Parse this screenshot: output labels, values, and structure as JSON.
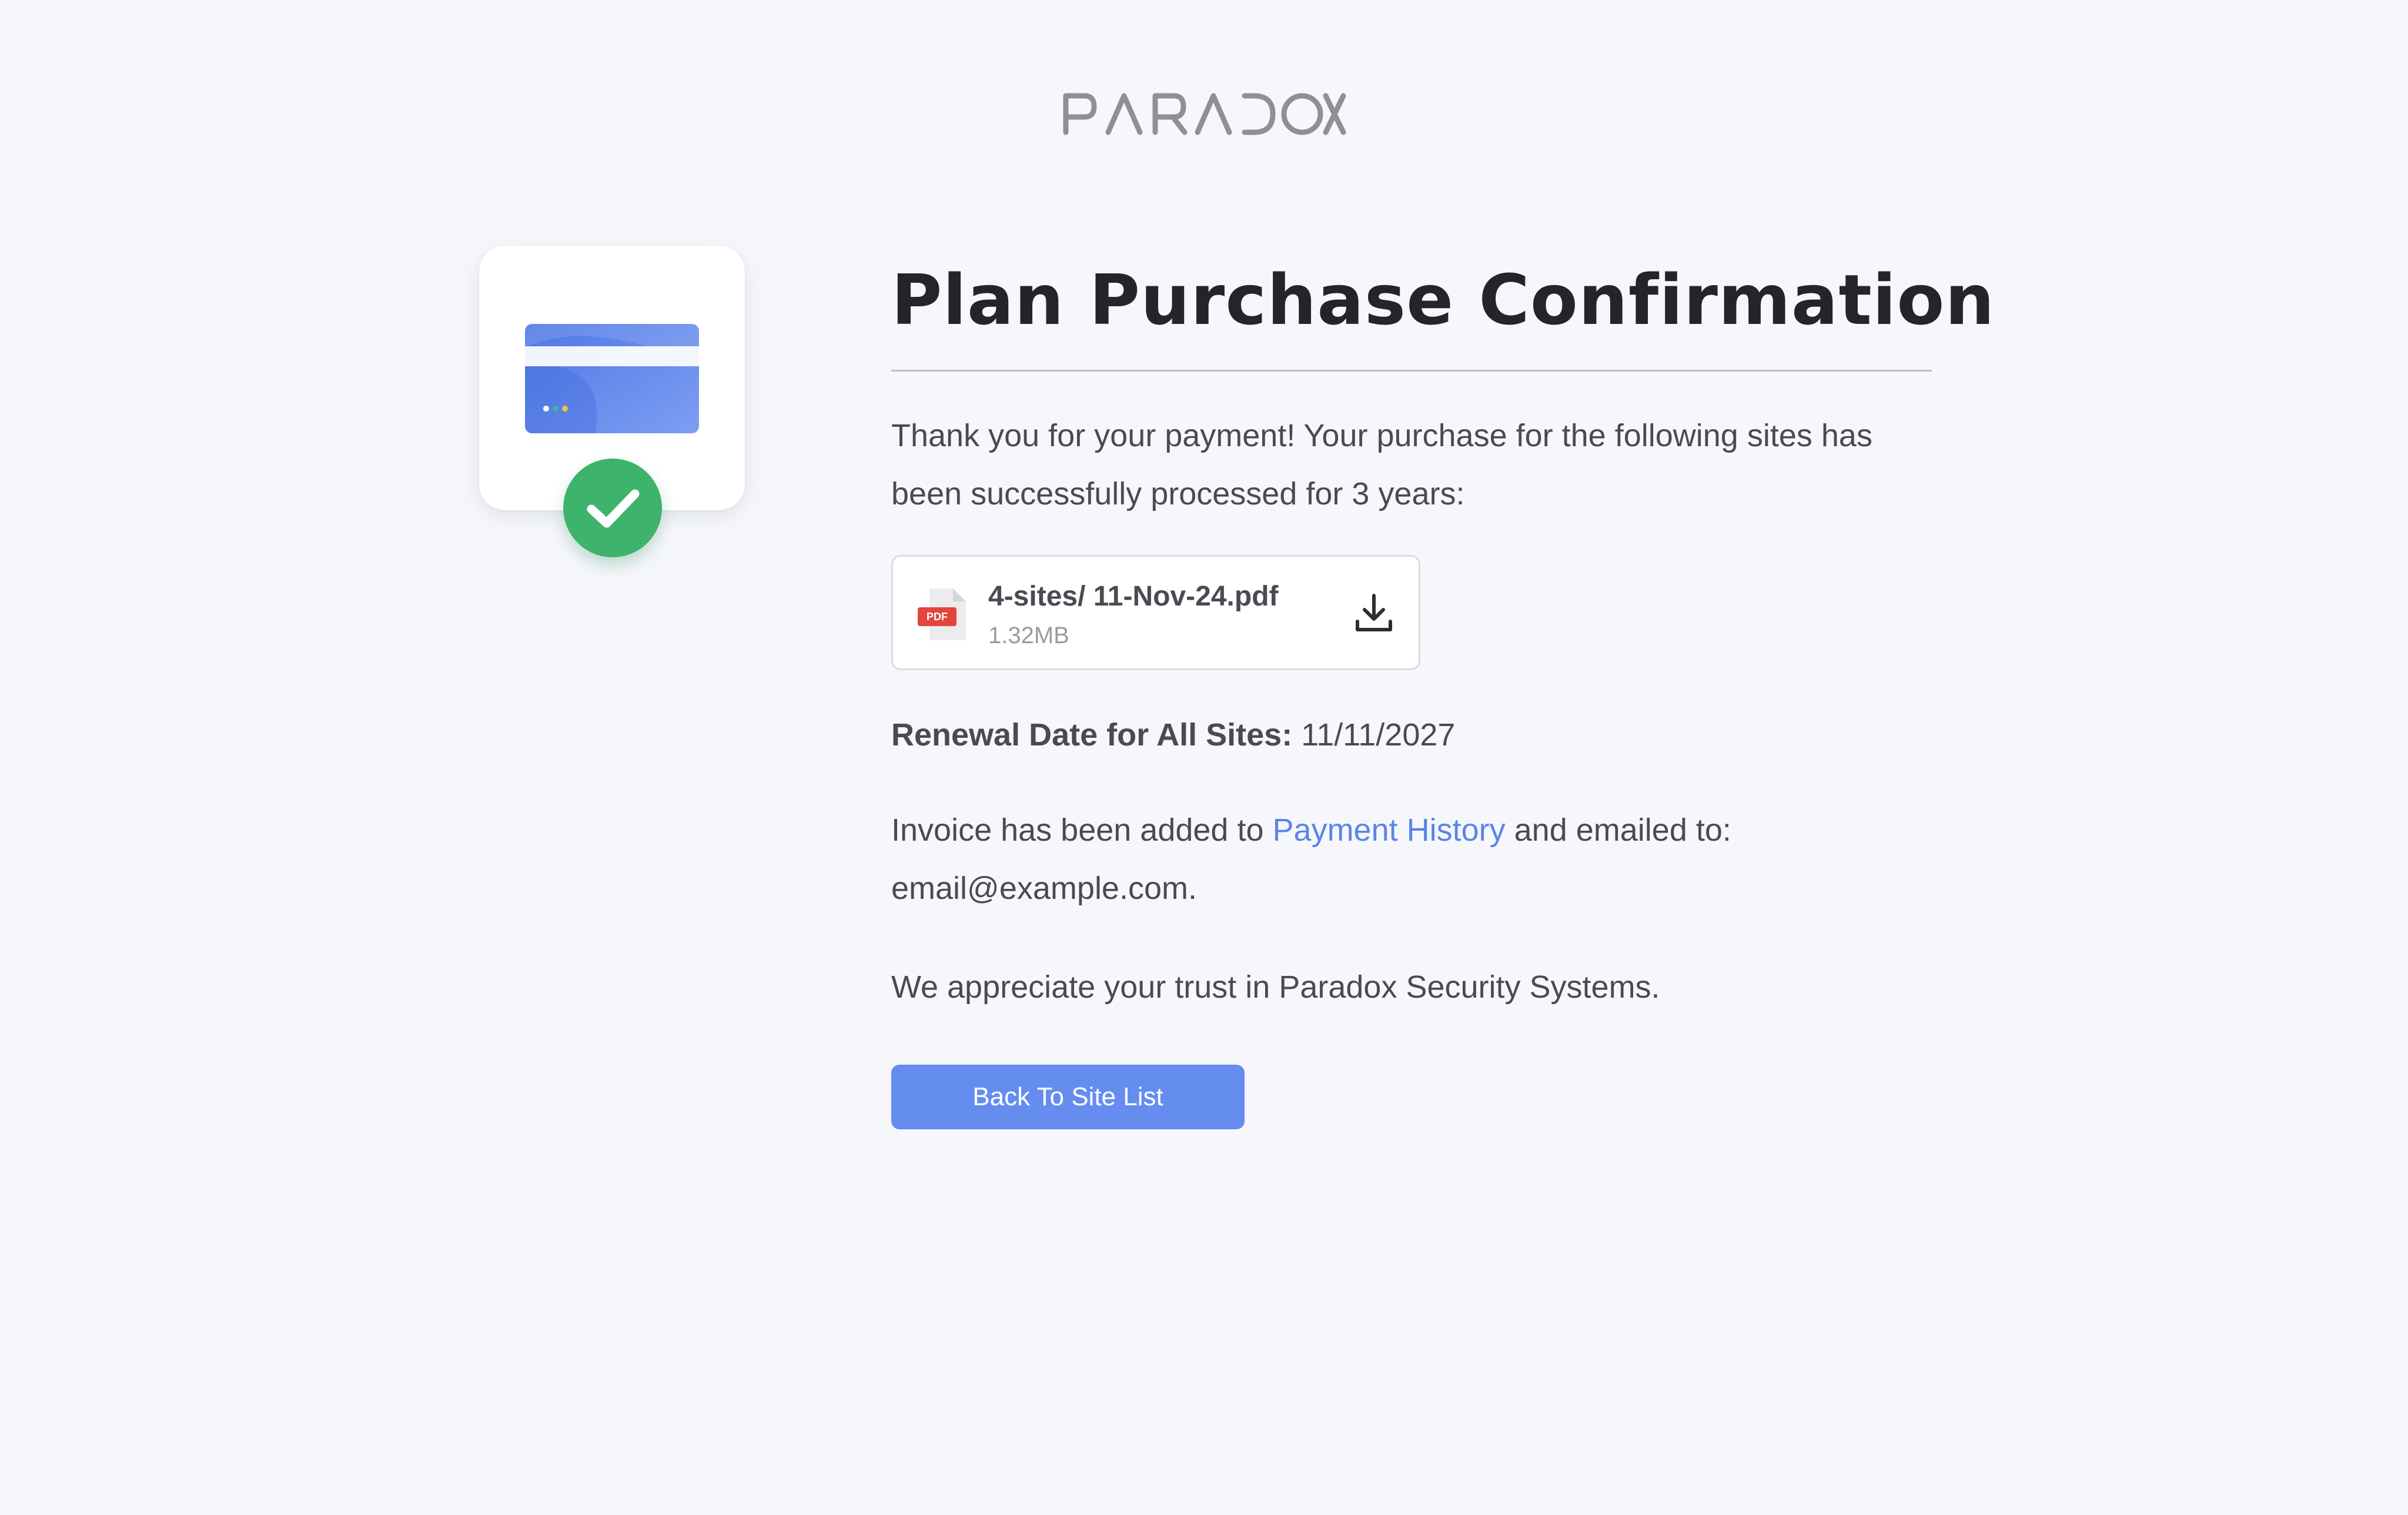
{
  "brand": {
    "name": "PARADOX",
    "color": "#8f9095"
  },
  "illustration": {
    "icon": "credit-card-icon",
    "badge_icon": "checkmark-icon",
    "card_color": "#5b84ea",
    "badge_color": "#3eb36c"
  },
  "page": {
    "title": "Plan Purchase Confirmation",
    "intro": "Thank you for your payment! Your purchase for the following sites has been successfully processed for 3 years:"
  },
  "attachment": {
    "icon": "pdf-file-icon",
    "badge_text": "PDF",
    "file_name": "4-sites/ 11-Nov-24.pdf",
    "file_size": "1.32MB",
    "action_icon": "download-icon"
  },
  "renewal": {
    "label": "Renewal Date for All Sites:",
    "date": "11/11/2027"
  },
  "invoice": {
    "prefix": "Invoice has been added to ",
    "link_label": "Payment History",
    "suffix": " and emailed to: email@example.com."
  },
  "closing": {
    "message": "We appreciate your trust in Paradox Security Systems."
  },
  "actions": {
    "back_label": "Back To Site List",
    "button_color": "#658df0",
    "link_color": "#5b84ea"
  }
}
